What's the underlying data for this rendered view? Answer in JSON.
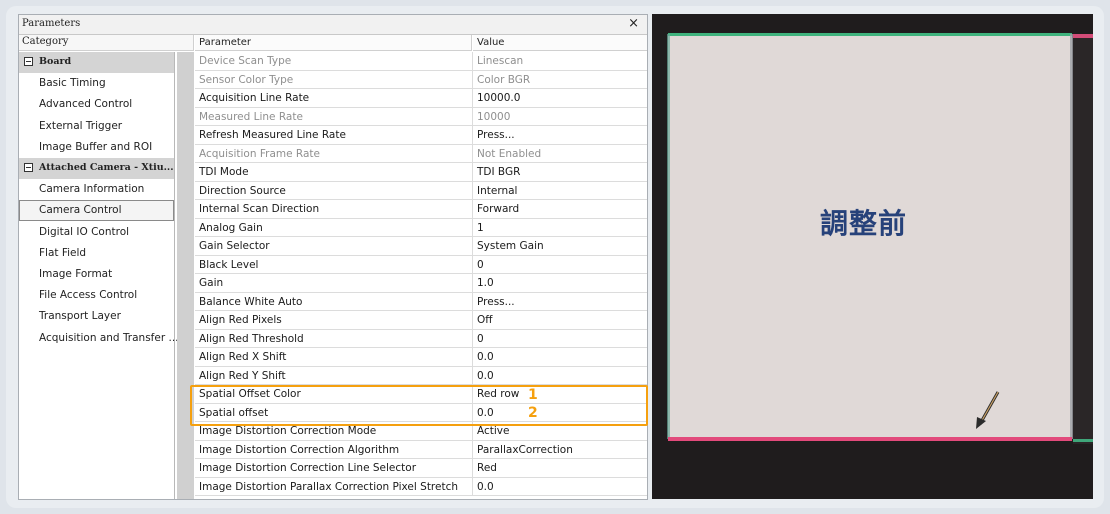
{
  "window": {
    "title": "Parameters",
    "close_glyph": "×"
  },
  "category": {
    "header": "Category",
    "items": [
      {
        "label": "Board",
        "group": true
      },
      {
        "label": "Basic Timing"
      },
      {
        "label": "Advanced Control"
      },
      {
        "label": "External Trigger"
      },
      {
        "label": "Image Buffer and ROI"
      },
      {
        "label": "Attached Camera - Xtiu...",
        "group": true
      },
      {
        "label": "Camera Information"
      },
      {
        "label": "Camera Control",
        "selected": true
      },
      {
        "label": "Digital IO Control"
      },
      {
        "label": "Flat Field"
      },
      {
        "label": "Image Format"
      },
      {
        "label": "File Access Control"
      },
      {
        "label": "Transport Layer"
      },
      {
        "label": "Acquisition and Transfer ..."
      }
    ]
  },
  "params": {
    "header_param": "Parameter",
    "header_value": "Value",
    "rows": [
      {
        "name": "Device Scan Type",
        "value": "Linescan",
        "dim": true
      },
      {
        "name": "Sensor Color Type",
        "value": "Color BGR",
        "dim": true
      },
      {
        "name": "Acquisition Line Rate",
        "value": "10000.0"
      },
      {
        "name": "Measured Line Rate",
        "value": "10000",
        "dim": true
      },
      {
        "name": "Refresh Measured Line Rate",
        "value": "Press..."
      },
      {
        "name": "Acquisition Frame Rate",
        "value": "Not Enabled",
        "dim": true
      },
      {
        "name": "TDI Mode",
        "value": "TDI BGR"
      },
      {
        "name": "Direction Source",
        "value": "Internal"
      },
      {
        "name": "Internal Scan Direction",
        "value": "Forward"
      },
      {
        "name": "Analog Gain",
        "value": "1"
      },
      {
        "name": "Gain Selector",
        "value": "System Gain"
      },
      {
        "name": "Black Level",
        "value": "0"
      },
      {
        "name": "Gain",
        "value": "1.0"
      },
      {
        "name": "Balance White Auto",
        "value": "Press..."
      },
      {
        "name": "Align Red Pixels",
        "value": "Off"
      },
      {
        "name": "Align Red Threshold",
        "value": "0"
      },
      {
        "name": "Align Red X Shift",
        "value": "0.0"
      },
      {
        "name": "Align Red Y Shift",
        "value": "0.0"
      },
      {
        "name": "Spatial Offset Color",
        "value": "Red row"
      },
      {
        "name": "Spatial offset",
        "value": "0.0"
      },
      {
        "name": "Image Distortion Correction Mode",
        "value": "Active"
      },
      {
        "name": "Image Distortion Correction Algorithm",
        "value": "ParallaxCorrection"
      },
      {
        "name": "Image Distortion Correction Line Selector",
        "value": "Red"
      },
      {
        "name": "Image Distortion Parallax Correction Pixel Stretch",
        "value": "0.0"
      }
    ]
  },
  "annotations": {
    "n1": "1",
    "n2": "2",
    "highlight_color": "#f5a00f"
  },
  "preview": {
    "label": "調整前",
    "label_color": "#27427a",
    "arrow_icon": "arrow-down-left-icon"
  }
}
